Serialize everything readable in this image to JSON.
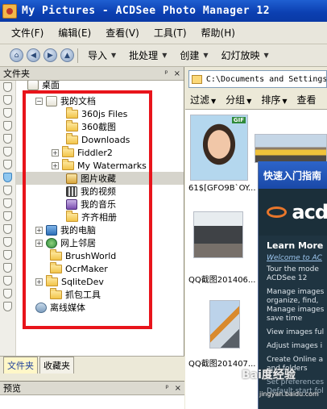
{
  "window": {
    "title": "My Pictures - ACDSee Photo Manager 12"
  },
  "menu": [
    "文件(F)",
    "编辑(E)",
    "查看(V)",
    "工具(T)",
    "帮助(H)"
  ],
  "toolbar": {
    "import": "导入",
    "batch": "批处理",
    "create": "创建",
    "slideshow": "幻灯放映"
  },
  "folder_pane": {
    "title": "文件夹",
    "pin": "ᵖ",
    "close": "×",
    "tree": [
      {
        "label": "桌面"
      },
      {
        "label": "我的文档"
      },
      {
        "label": "360js Files"
      },
      {
        "label": "360截图"
      },
      {
        "label": "Downloads"
      },
      {
        "label": "Fiddler2"
      },
      {
        "label": "My Watermarks"
      },
      {
        "label": "图片收藏"
      },
      {
        "label": "我的视频"
      },
      {
        "label": "我的音乐"
      },
      {
        "label": "齐齐相册"
      },
      {
        "label": "我的电脑"
      },
      {
        "label": "网上邻居"
      },
      {
        "label": "BrushWorld"
      },
      {
        "label": "OcrMaker"
      },
      {
        "label": "SqliteDev"
      },
      {
        "label": "抓包工具"
      },
      {
        "label": "离线媒体"
      }
    ],
    "tabs": {
      "folders": "文件夹",
      "favorites": "收藏夹"
    }
  },
  "preview_pane": {
    "title": "预览",
    "close": "×"
  },
  "browser": {
    "path": "C:\\Documents and Settings",
    "filters": {
      "filter": "过滤",
      "group": "分组",
      "sort": "排序",
      "view": "查看"
    },
    "thumbs": [
      {
        "caption": "61$[GFO9B`OY...",
        "badge": "GIF"
      },
      {
        "caption": "QQ截图201406..."
      },
      {
        "caption": "QQ截图201407..."
      }
    ]
  },
  "quick_start": {
    "title": "快速入门指南",
    "logo_text": "acd",
    "learn_more": "Learn More",
    "welcome": "Welcome to AC",
    "lines": [
      "Tour the mode",
      "ACDSee 12",
      "Manage images",
      "organize, find,",
      "Manage images",
      "save time",
      "View images ful",
      "Adjust images i",
      "Create Online a",
      "and folders",
      "Set preferences",
      "Default start fol"
    ]
  },
  "watermark": {
    "brand": "Bai度经验",
    "url": "jingyan.baidu.com"
  },
  "colors": {
    "highlight": "#e8141b",
    "titlebar": "#0b3fb0"
  }
}
